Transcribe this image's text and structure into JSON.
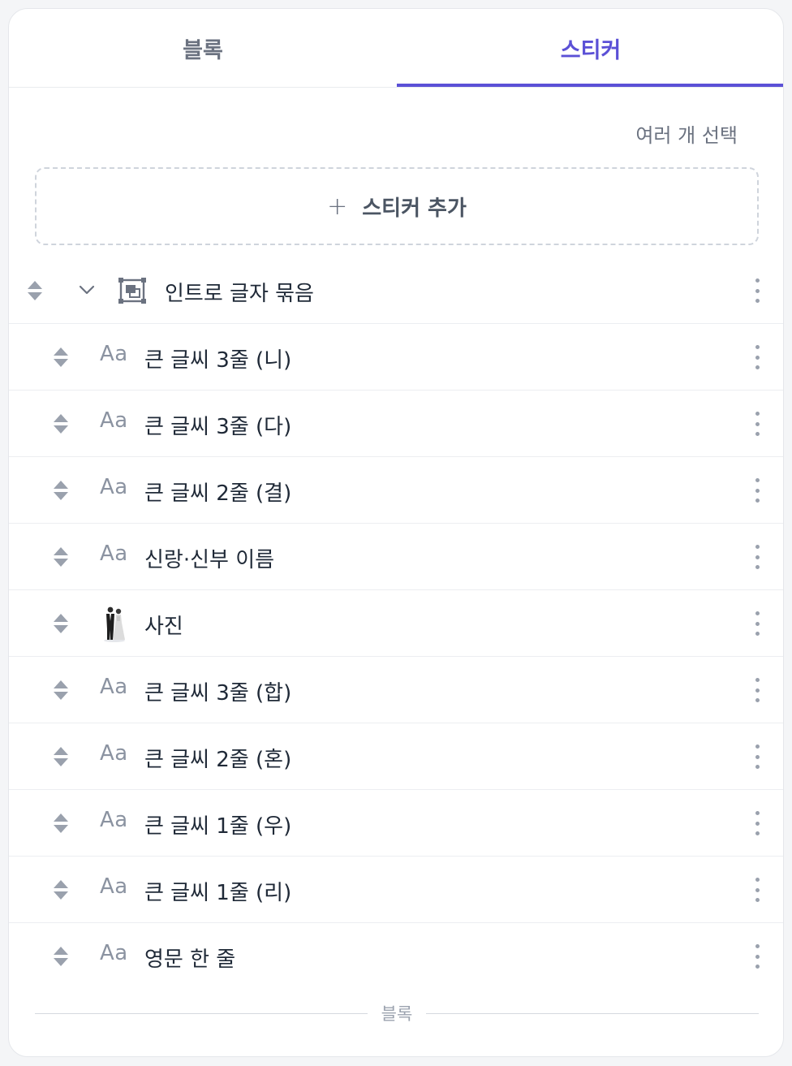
{
  "tabs": [
    {
      "label": "블록",
      "active": false
    },
    {
      "label": "스티커",
      "active": true
    }
  ],
  "colors": {
    "accent": "#5b50d6",
    "muted": "#6b7280",
    "border": "#e5e7eb"
  },
  "multi_select_label": "여러 개 선택",
  "add_sticker": {
    "icon": "plus-icon",
    "label": "스티커 추가"
  },
  "group": {
    "name": "인트로 글자 묶음",
    "icon": "group-frame-icon",
    "expanded": true
  },
  "items": [
    {
      "type": "text",
      "icon_label": "Aa",
      "name": "큰 글씨 3줄 (니)"
    },
    {
      "type": "text",
      "icon_label": "Aa",
      "name": "큰 글씨 3줄 (다)"
    },
    {
      "type": "text",
      "icon_label": "Aa",
      "name": "큰 글씨 2줄 (결)"
    },
    {
      "type": "text",
      "icon_label": "Aa",
      "name": "신랑·신부 이름"
    },
    {
      "type": "image",
      "icon_label": "",
      "name": "사진"
    },
    {
      "type": "text",
      "icon_label": "Aa",
      "name": "큰 글씨 3줄 (합)"
    },
    {
      "type": "text",
      "icon_label": "Aa",
      "name": "큰 글씨 2줄 (혼)"
    },
    {
      "type": "text",
      "icon_label": "Aa",
      "name": "큰 글씨 1줄 (우)"
    },
    {
      "type": "text",
      "icon_label": "Aa",
      "name": "큰 글씨 1줄 (리)"
    },
    {
      "type": "text",
      "icon_label": "Aa",
      "name": "영문 한 줄"
    }
  ],
  "divider_label": "블록"
}
